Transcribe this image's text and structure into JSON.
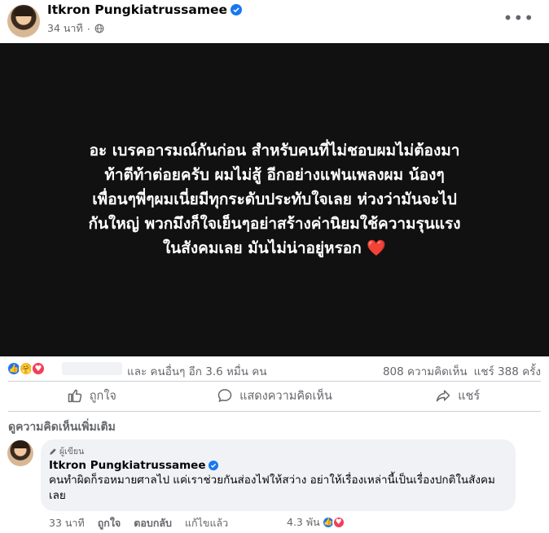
{
  "post": {
    "author": "Itkron Pungkiatrussamee",
    "time": "34 นาที",
    "text_lines": [
      "อะ เบรคอารมณ์กันก่อน สำหรับคนที่ไม่ชอบผมไม่ต้องมา",
      "ท้าตีท้าต่อยครับ ผมไม่สู้ อีกอย่างแฟนเพลงผม น้องๆ",
      "เพื่อนๆพี่ๆผมเนี่ยมีทุกระดับประทับใจเลย ห่วงว่ามันจะไป",
      "กันใหญ่ พวกมึงก็ใจเย็นๆอย่าสร้างค่านิยมใช้ความรุนแรง",
      "ในสังคมเลย มันไม่น่าอยู่หรอก"
    ],
    "heart_emoji": "❤️",
    "background": "#111111"
  },
  "reactions": {
    "summary": "และ คนอื่นๆ อีก 3.6 หมื่น คน",
    "comments": "808 ความคิดเห็น",
    "shares": "แชร์ 388 ครั้ง"
  },
  "actions": {
    "like": "ถูกใจ",
    "comment": "แสดงความคิดเห็น",
    "share": "แชร์"
  },
  "more_comments": "ดูความคิดเห็นเพิ่มเติม",
  "comment": {
    "badge": "ผู้เขียน",
    "author": "Itkron Pungkiatrussamee",
    "text": "คนทำผิดก็รอหมายศาลไป แค่เราช่วยกันส่องไฟให้สว่าง อย่าให้เรื่องเหล่านี้เป็นเรื่องปกติในสังคมเลย",
    "time": "33 นาที",
    "like": "ถูกใจ",
    "reply": "ตอบกลับ",
    "edited": "แก้ไขแล้ว",
    "reaction_count": "4.3 พัน"
  },
  "colors": {
    "brand_blue": "#1877f2",
    "secondary_text": "#65676b",
    "bubble": "#f0f2f5"
  }
}
